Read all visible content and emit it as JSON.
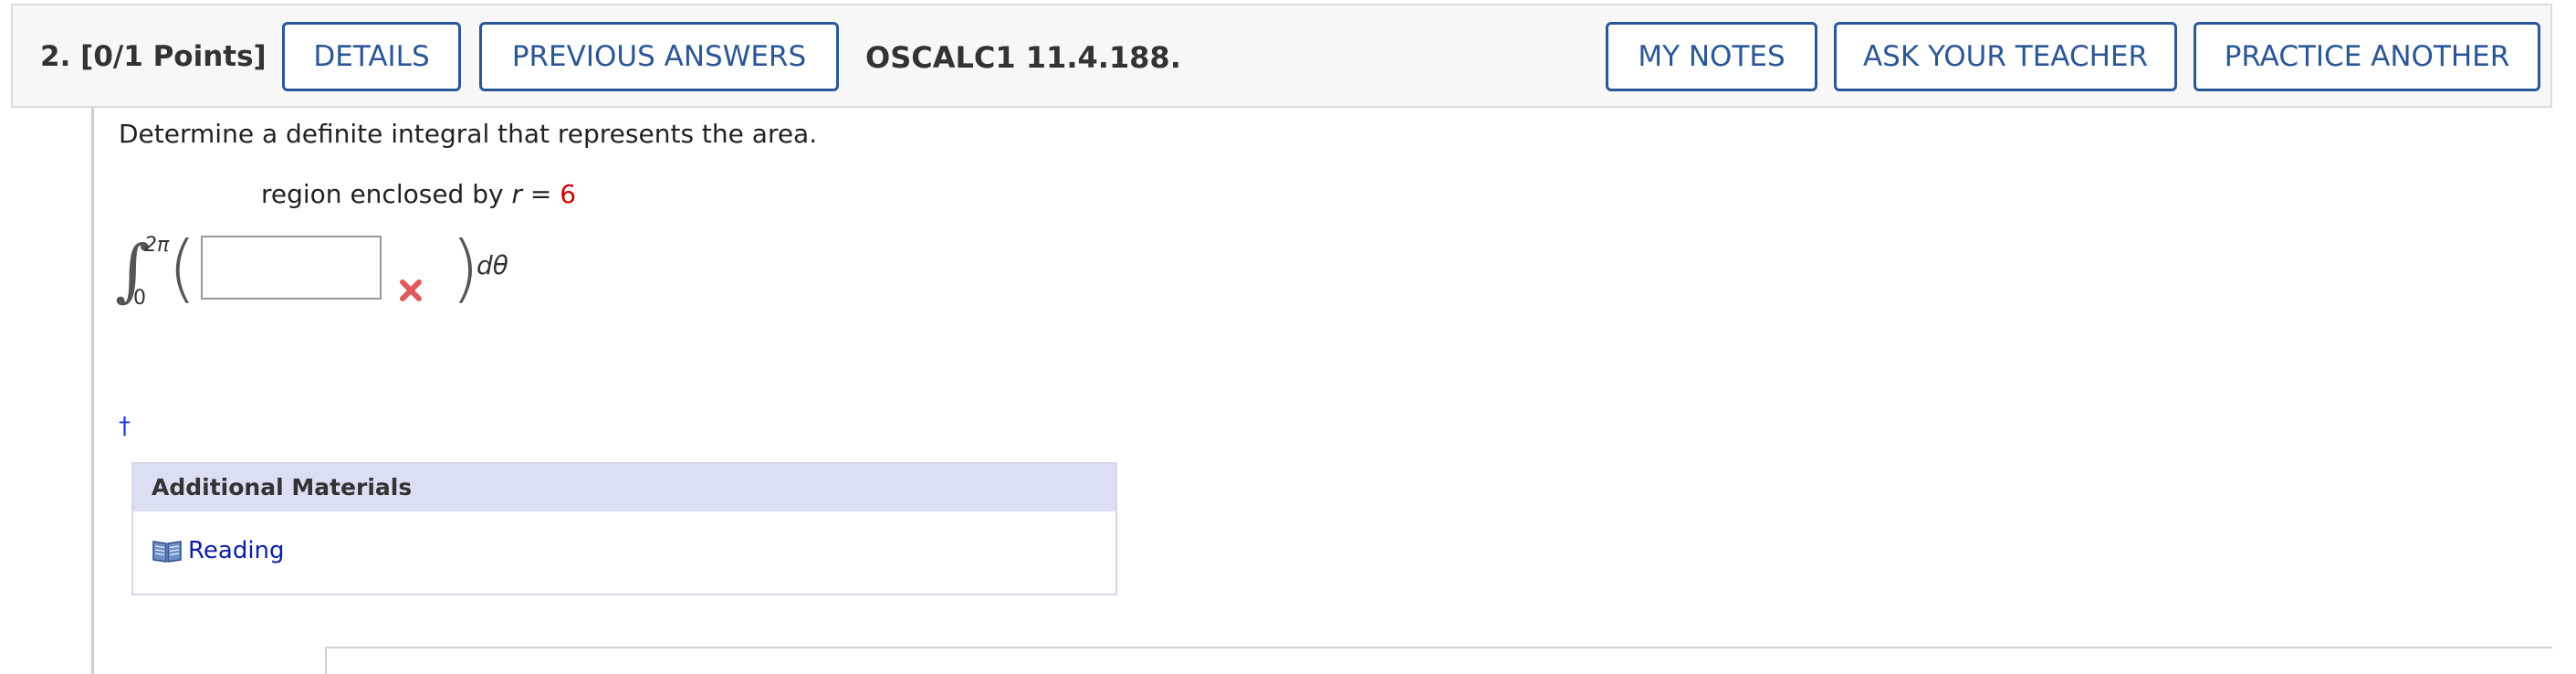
{
  "header": {
    "question_number": "2.",
    "points": "[0/1 Points]",
    "details_label": "DETAILS",
    "previous_answers_label": "PREVIOUS ANSWERS",
    "question_ref": "OSCALC1 11.4.188.",
    "my_notes_label": "MY NOTES",
    "ask_teacher_label": "ASK YOUR TEACHER",
    "practice_another_label": "PRACTICE ANOTHER"
  },
  "question": {
    "prompt": "Determine a definite integral that represents the area.",
    "region_text": "region enclosed by ",
    "region_var": "r",
    "region_eq": " = ",
    "region_value": "6",
    "integral_upper": "2π",
    "integral_lower": "0",
    "answer_value": "",
    "differential": "dθ",
    "answer_status": "incorrect"
  },
  "footnote": {
    "dagger": "†"
  },
  "materials": {
    "title": "Additional Materials",
    "items": [
      {
        "label": "Reading",
        "icon": "book-icon"
      }
    ]
  },
  "colors": {
    "button_border": "#2b5797",
    "wrong_mark": "#e05a5a",
    "materials_header": "#dadff4",
    "link": "#0a1ea8",
    "value_red": "#d00000"
  }
}
